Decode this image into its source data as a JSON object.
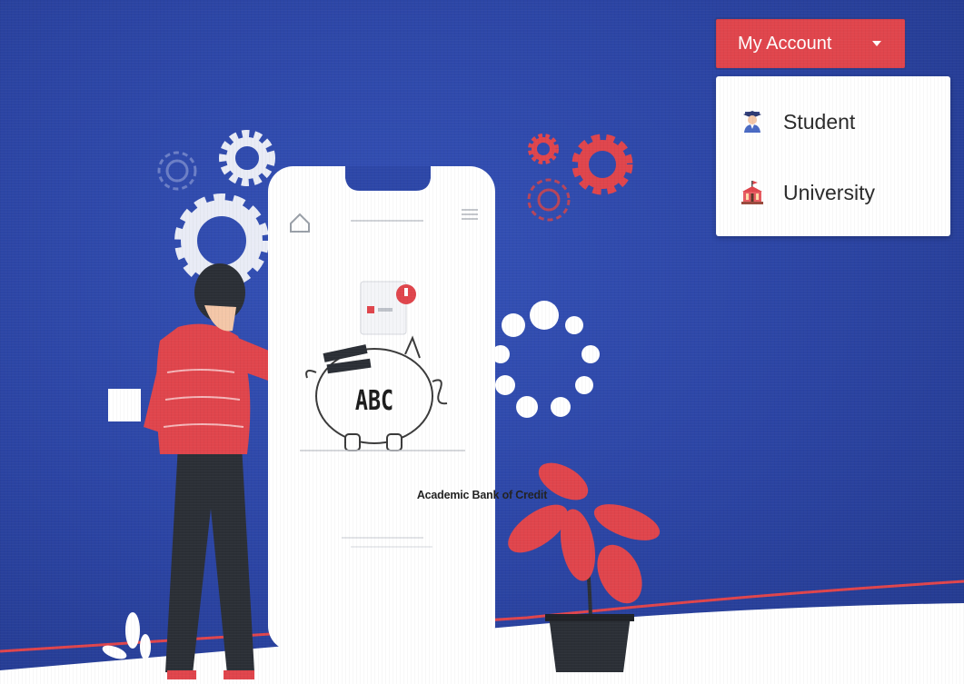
{
  "account_button": {
    "label": "My Account"
  },
  "menu": {
    "items": [
      {
        "label": "Student",
        "icon": "student-graduate-icon"
      },
      {
        "label": "University",
        "icon": "university-building-icon"
      }
    ]
  },
  "phone": {
    "title": "Academic Bank of Credit",
    "logo_text": "ABC"
  },
  "colors": {
    "background": "#2d47a8",
    "accent": "#e0454c",
    "dark": "#2b2f36"
  }
}
